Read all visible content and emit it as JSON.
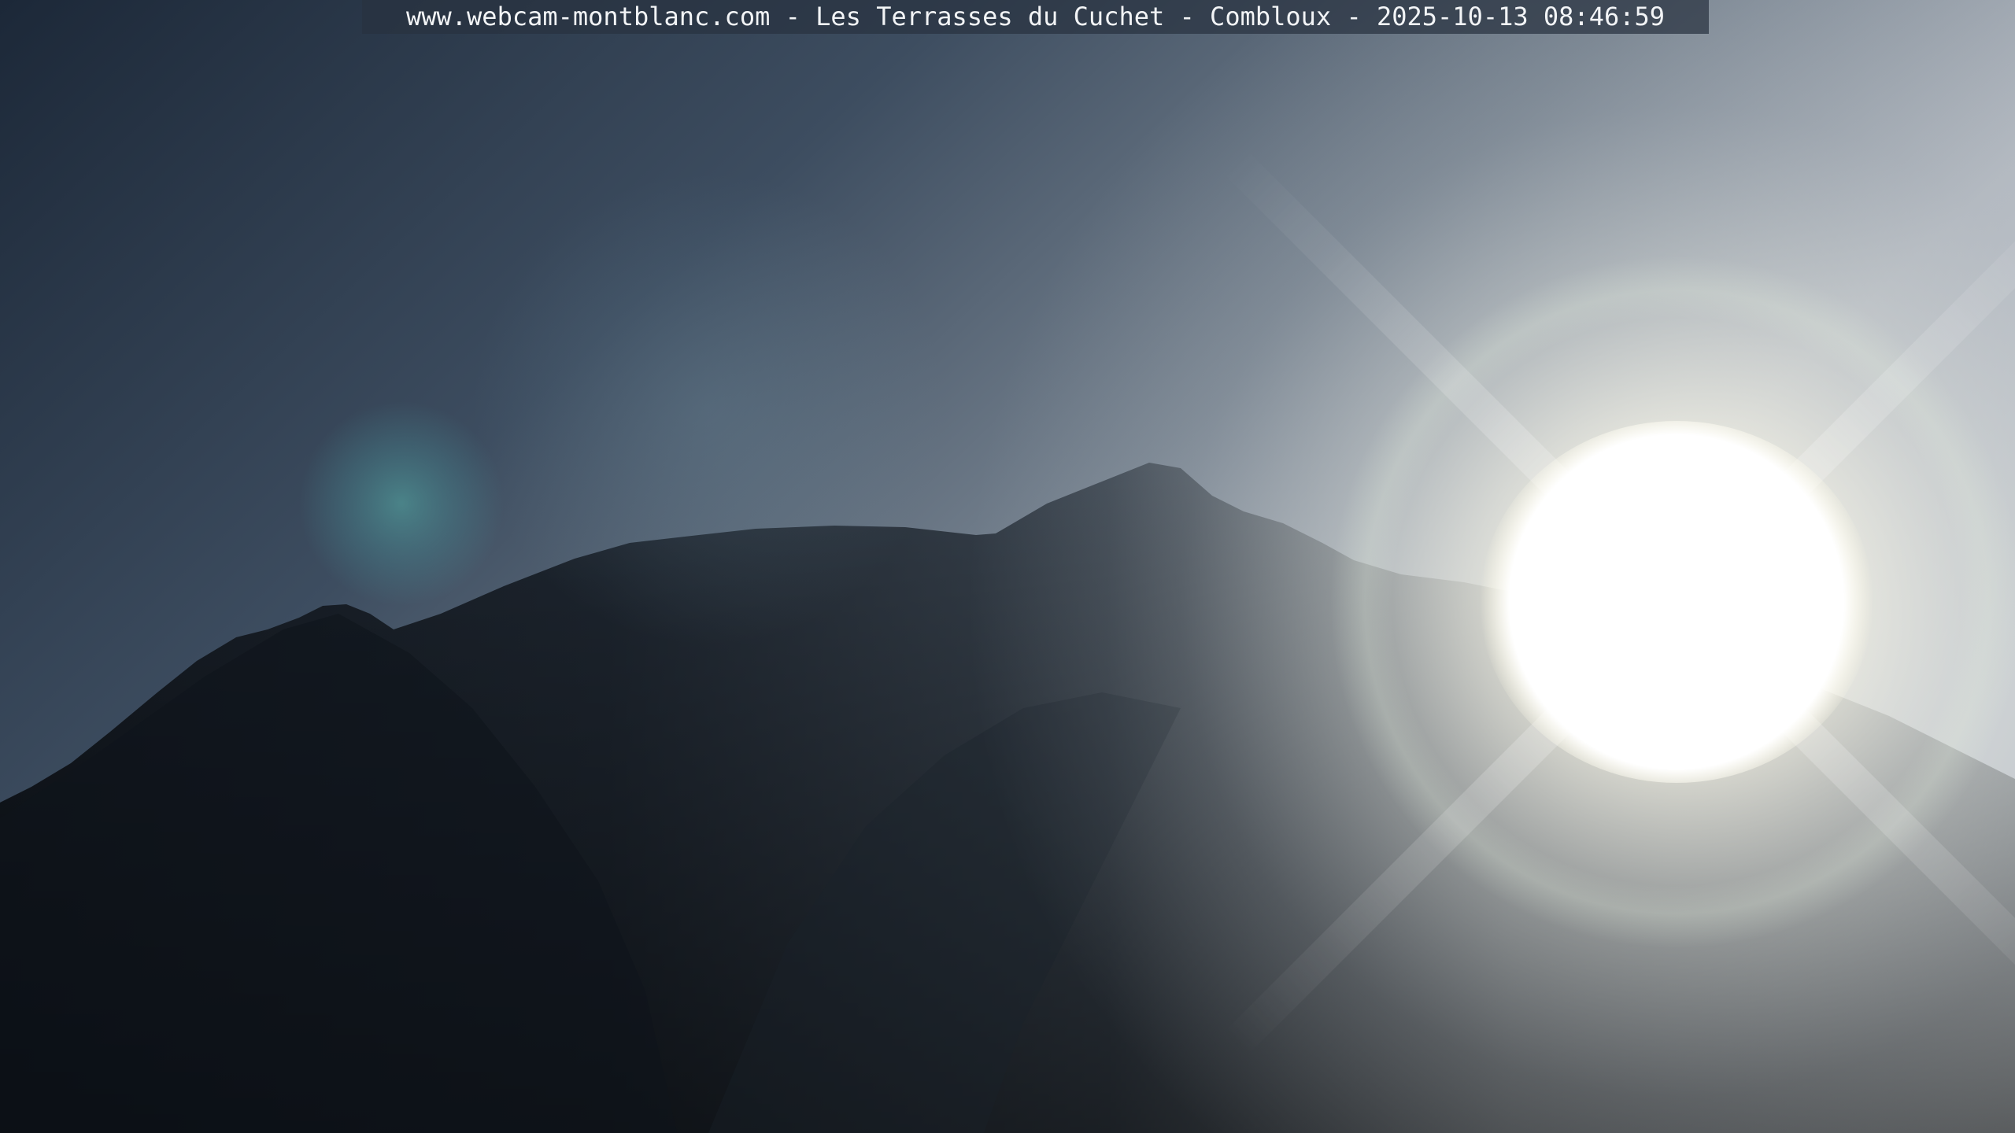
{
  "webcam": {
    "caption": "www.webcam-montblanc.com - Les Terrasses du Cuchet - Combloux - 2025-10-13 08:46:59"
  },
  "colors": {
    "sky_dark": "#1f2c3d",
    "sky_mid": "#5d6e80",
    "sky_bright": "#c9d0d6",
    "mountain_dark": "#151b24",
    "sun_core": "#ffffff",
    "sun_glow": "#fffbe6",
    "flare_teal": "#4fa6a8"
  }
}
